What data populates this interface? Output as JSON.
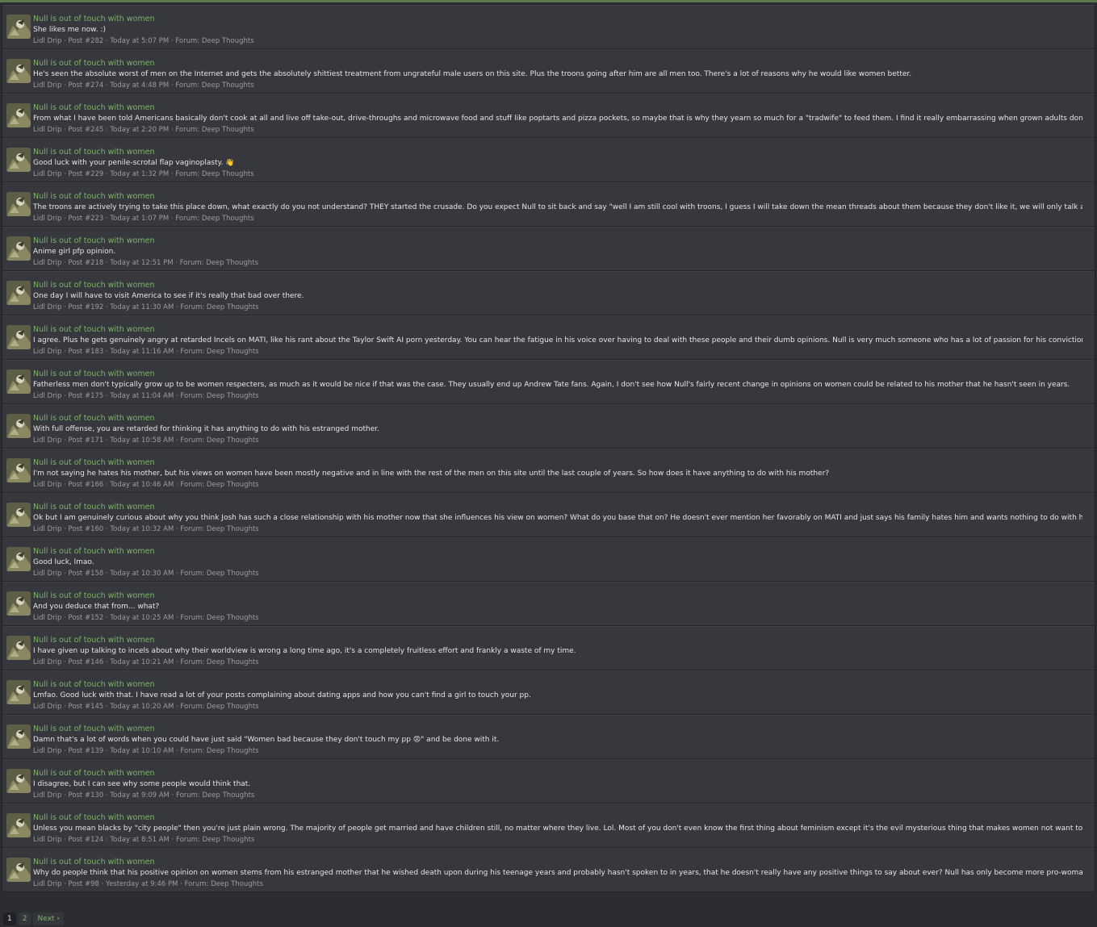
{
  "results": [
    {
      "title": "Null is out of touch with women",
      "snippet": "She likes me now. :)",
      "author": "Lidl Drip",
      "post": "Post #282",
      "time": "Today at 5:07 PM",
      "forum_label": "Forum:",
      "forum": "Deep Thoughts"
    },
    {
      "title": "Null is out of touch with women",
      "snippet": "He's seen the absolute worst of men on the Internet and gets the absolutely shittiest treatment from ungrateful male users on this site. Plus the troons going after him are all men too. There's a lot of reasons why he would like women better.",
      "author": "Lidl Drip",
      "post": "Post #274",
      "time": "Today at 4:48 PM",
      "forum_label": "Forum:",
      "forum": "Deep Thoughts"
    },
    {
      "title": "Null is out of touch with women",
      "snippet": "From what I have been told Americans basically don't cook at all and live off take-out, drive-throughs and microwave food and stuff like poptarts and pizza pockets, so maybe that is why they yearn so much for a \"tradwife\" to feed them. I find it really embarrassing when grown adults don't know...",
      "author": "Lidl Drip",
      "post": "Post #245",
      "time": "Today at 2:20 PM",
      "forum_label": "Forum:",
      "forum": "Deep Thoughts"
    },
    {
      "title": "Null is out of touch with women",
      "snippet": "Good luck with your penile-scrotal flap vaginoplasty. 👋",
      "author": "Lidl Drip",
      "post": "Post #229",
      "time": "Today at 1:32 PM",
      "forum_label": "Forum:",
      "forum": "Deep Thoughts"
    },
    {
      "title": "Null is out of touch with women",
      "snippet": "The troons are actively trying to take this place down, what exactly do you not understand? THEY started the crusade. Do you expect Null to sit back and say \"well I am still cool with troons, I guess I will take down the mean threads about them because they don't like it, we will only talk about...",
      "author": "Lidl Drip",
      "post": "Post #223",
      "time": "Today at 1:07 PM",
      "forum_label": "Forum:",
      "forum": "Deep Thoughts"
    },
    {
      "title": "Null is out of touch with women",
      "snippet": "Anime girl pfp opinion.",
      "author": "Lidl Drip",
      "post": "Post #218",
      "time": "Today at 12:51 PM",
      "forum_label": "Forum:",
      "forum": "Deep Thoughts"
    },
    {
      "title": "Null is out of touch with women",
      "snippet": "One day I will have to visit America to see if it's really that bad over there.",
      "author": "Lidl Drip",
      "post": "Post #192",
      "time": "Today at 11:30 AM",
      "forum_label": "Forum:",
      "forum": "Deep Thoughts"
    },
    {
      "title": "Null is out of touch with women",
      "snippet": "I agree. Plus he gets genuinely angry at retarded Incels on MATI, like his rant about the Taylor Swift AI porn yesterday. You can hear the fatigue in his voice over having to deal with these people and their dumb opinions. Null is very much someone who has a lot of passion for his convictions in...",
      "author": "Lidl Drip",
      "post": "Post #183",
      "time": "Today at 11:16 AM",
      "forum_label": "Forum:",
      "forum": "Deep Thoughts"
    },
    {
      "title": "Null is out of touch with women",
      "snippet": "Fatherless men don't typically grow up to be women respecters, as much as it would be nice if that was the case. They usually end up Andrew Tate fans. Again, I don't see how Null's fairly recent change in opinions on women could be related to his mother that he hasn't seen in years.",
      "author": "Lidl Drip",
      "post": "Post #175",
      "time": "Today at 11:04 AM",
      "forum_label": "Forum:",
      "forum": "Deep Thoughts"
    },
    {
      "title": "Null is out of touch with women",
      "snippet": "With full offense, you are retarded for thinking it has anything to do with his estranged mother.",
      "author": "Lidl Drip",
      "post": "Post #171",
      "time": "Today at 10:58 AM",
      "forum_label": "Forum:",
      "forum": "Deep Thoughts"
    },
    {
      "title": "Null is out of touch with women",
      "snippet": "I'm not saying he hates his mother, but his views on women have been mostly negative and in line with the rest of the men on this site until the last couple of years. So how does it have anything to do with his mother?",
      "author": "Lidl Drip",
      "post": "Post #166",
      "time": "Today at 10:46 AM",
      "forum_label": "Forum:",
      "forum": "Deep Thoughts"
    },
    {
      "title": "Null is out of touch with women",
      "snippet": "Ok but I am genuinely curious about why you think Josh has such a close relationship with his mother now that she influences his view on women? What do you base that on? He doesn't ever mention her favorably on MATI and just says his family hates him and wants nothing to do with him because...",
      "author": "Lidl Drip",
      "post": "Post #160",
      "time": "Today at 10:32 AM",
      "forum_label": "Forum:",
      "forum": "Deep Thoughts"
    },
    {
      "title": "Null is out of touch with women",
      "snippet": "Good luck, lmao.",
      "author": "Lidl Drip",
      "post": "Post #158",
      "time": "Today at 10:30 AM",
      "forum_label": "Forum:",
      "forum": "Deep Thoughts"
    },
    {
      "title": "Null is out of touch with women",
      "snippet": "And you deduce that from... what?",
      "author": "Lidl Drip",
      "post": "Post #152",
      "time": "Today at 10:25 AM",
      "forum_label": "Forum:",
      "forum": "Deep Thoughts"
    },
    {
      "title": "Null is out of touch with women",
      "snippet": "I have given up talking to incels about why their worldview is wrong a long time ago, it's a completely fruitless effort and frankly a waste of my time.",
      "author": "Lidl Drip",
      "post": "Post #146",
      "time": "Today at 10:21 AM",
      "forum_label": "Forum:",
      "forum": "Deep Thoughts"
    },
    {
      "title": "Null is out of touch with women",
      "snippet": "Lmfao. Good luck with that. I have read a lot of your posts complaining about dating apps and how you can't find a girl to touch your pp.",
      "author": "Lidl Drip",
      "post": "Post #145",
      "time": "Today at 10:20 AM",
      "forum_label": "Forum:",
      "forum": "Deep Thoughts"
    },
    {
      "title": "Null is out of touch with women",
      "snippet": "Damn that's a lot of words when you could have just said \"Women bad because they don't touch my pp 😡\" and be done with it.",
      "author": "Lidl Drip",
      "post": "Post #139",
      "time": "Today at 10:10 AM",
      "forum_label": "Forum:",
      "forum": "Deep Thoughts"
    },
    {
      "title": "Null is out of touch with women",
      "snippet": "I disagree, but I can see why some people would think that.",
      "author": "Lidl Drip",
      "post": "Post #130",
      "time": "Today at 9:09 AM",
      "forum_label": "Forum:",
      "forum": "Deep Thoughts"
    },
    {
      "title": "Null is out of touch with women",
      "snippet": "Unless you mean blacks by \"city people\" then you're just plain wrong. The majority of people get married and have children still, no matter where they live. Lol. Most of you don't even know the first thing about feminism except it's the evil mysterious thing that makes women not want to be your...",
      "author": "Lidl Drip",
      "post": "Post #124",
      "time": "Today at 8:51 AM",
      "forum_label": "Forum:",
      "forum": "Deep Thoughts"
    },
    {
      "title": "Null is out of touch with women",
      "snippet": "Why do people think that his positive opinion on women stems from his estranged mother that he wished death upon during his teenage years and probably hasn't spoken to in years, that he doesn't really have any positive things to say about ever? Null has only become more pro-woman in the last...",
      "author": "Lidl Drip",
      "post": "Post #98",
      "time": "Yesterday at 9:46 PM",
      "forum_label": "Forum:",
      "forum": "Deep Thoughts"
    }
  ],
  "pagination": {
    "current": "1",
    "other": "2",
    "next": "Next ›"
  },
  "colors": {
    "title": "#7fb36b",
    "snippet": "#e6e6e6",
    "meta": "#9a9ca1",
    "row_bg": "#36383d",
    "page_bg": "#2b2d31"
  }
}
